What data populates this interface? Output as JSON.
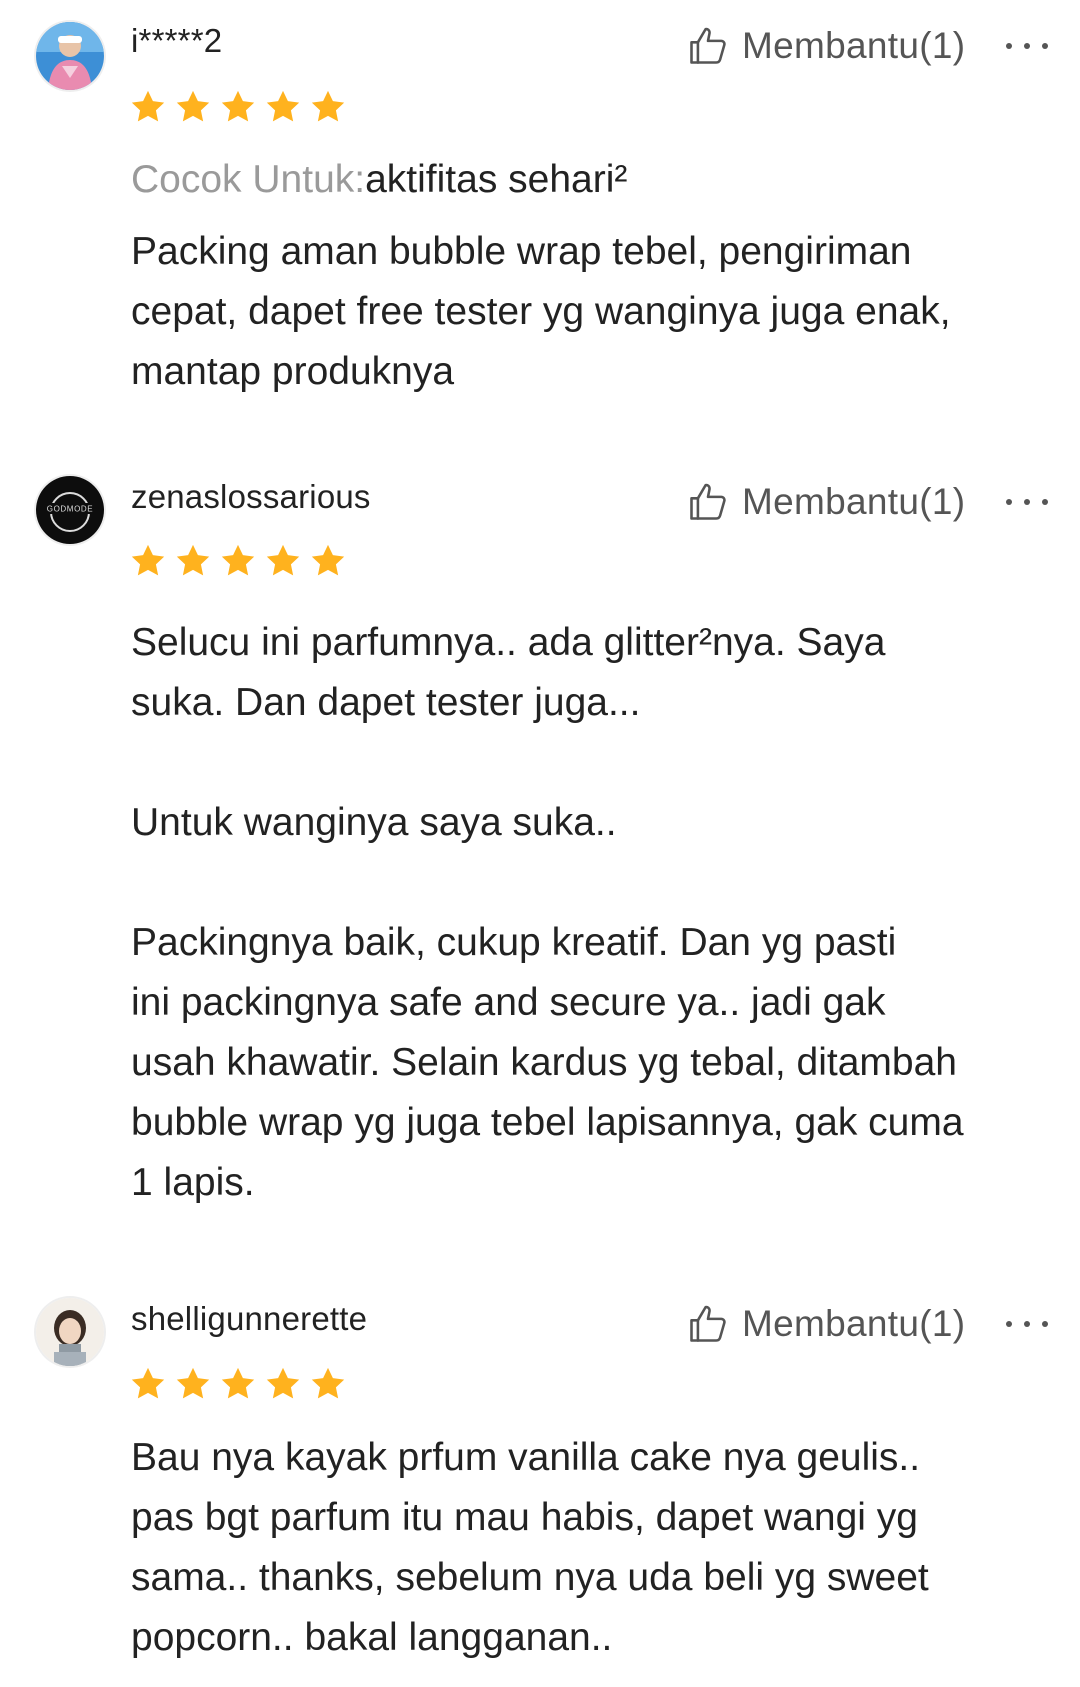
{
  "reviews": [
    {
      "username": "i*****2",
      "rating": 5,
      "helpful_label": "Membantu(1)",
      "suitable_label": "Cocok Untuk:",
      "suitable_value": "aktifitas sehari²",
      "lines": [
        "Packing aman bubble wrap tebel, pengiriman",
        "cepat, dapet free tester yg wanginya juga enak,",
        "mantap produknya"
      ]
    },
    {
      "username": "zenaslossarious",
      "rating": 5,
      "helpful_label": "Membantu(1)",
      "avatar_text": "GODMODE",
      "lines": [
        "Selucu ini parfumnya.. ada glitter²nya. Saya",
        "suka. Dan dapet tester juga...",
        "",
        "Untuk wanginya saya suka..",
        "",
        "Packingnya baik, cukup kreatif. Dan yg pasti",
        "ini packingnya safe and secure ya.. jadi gak",
        "usah khawatir. Selain kardus yg tebal, ditambah",
        "bubble wrap yg juga tebel lapisannya, gak cuma",
        "1 lapis."
      ]
    },
    {
      "username": "shelligunnerette",
      "rating": 5,
      "helpful_label": "Membantu(1)",
      "lines": [
        "Bau nya kayak prfum vanilla cake nya geulis..",
        "pas bgt parfum itu mau habis, dapet wangi yg",
        "sama.. thanks, sebelum nya uda beli yg sweet",
        "popcorn.. bakal langganan.."
      ]
    }
  ],
  "colors": {
    "star": "#FFB21E",
    "text": "#222222",
    "muted": "#9a9a9a",
    "icon": "#555555"
  },
  "icons": {
    "helpful": "thumbs-up-outline-icon",
    "more": "more-horizontal-icon",
    "star": "star-icon"
  }
}
